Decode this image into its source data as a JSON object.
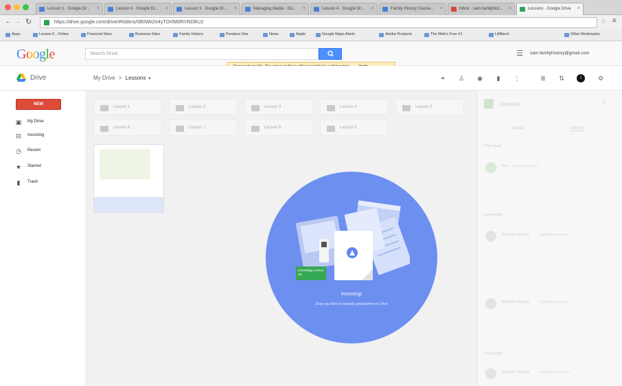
{
  "browser": {
    "tabs": [
      {
        "label": "Lesson 1 · Google Dr..."
      },
      {
        "label": "Lesson 6 · Google Dr..."
      },
      {
        "label": "Lesson 3 · Google Dr..."
      },
      {
        "label": "Managing Media · Do..."
      },
      {
        "label": "Lesson 4 · Google Dr..."
      },
      {
        "label": "Family History Classe..."
      },
      {
        "label": "Inbox · sam.familyhist..."
      },
      {
        "label": "Lessons · Google Drive"
      }
    ],
    "url": "https://drive.google.com/drive/#folders/0B0WkZe4yTOr0M0RVNDlkU2",
    "bookmarks": [
      "Apps",
      "Lesson 6 · Online",
      "Financial Sites",
      "Business Sites",
      "Family History",
      "Pandora One",
      "News",
      "Apple",
      "Google Maps Alerts",
      "Adobe Products",
      "The Web's Free #1",
      "LABtech",
      "Other Bookmarks"
    ]
  },
  "google_bar": {
    "logo": "Google",
    "search_placeholder": "Search Drive",
    "account": "sam.familyhistory@gmail.com"
  },
  "notification": {
    "message": "Removed one file. The removed file is still accessible by collaborators.",
    "undo": "Undo"
  },
  "drive_bar": {
    "app_name": "Drive",
    "breadcrumb_root": "My Drive",
    "breadcrumb_sep": ">",
    "breadcrumb_current": "Lessons"
  },
  "sidebar": {
    "new_label": "NEW",
    "items": [
      {
        "label": "My Drive"
      },
      {
        "label": "Incoming"
      },
      {
        "label": "Recent"
      },
      {
        "label": "Starred"
      },
      {
        "label": "Trash"
      }
    ]
  },
  "folders": [
    "Lesson 1",
    "Lesson 2",
    "Lesson 3",
    "Lesson 4",
    "Lesson 5",
    "Lesson 6",
    "Lesson 7",
    "Lesson 8",
    "Lesson 9"
  ],
  "upload_overlay": {
    "sticker_text": "Genealogy Lesson 4B",
    "title": "Incoming!",
    "subtitle": "Drop your files to instantly upload them to Drive"
  },
  "details_panel": {
    "title": "Lessons",
    "tabs": [
      "Details",
      "Activity"
    ],
    "sections": [
      "This week",
      "Last month",
      "Last month"
    ],
    "entries": [
      {
        "user": "You",
        "text": "moved an item"
      },
      {
        "user": "Stephen Shipley",
        "text": "uploaded an item"
      },
      {
        "user": "Stephen Shipley",
        "text": "uploaded an item"
      },
      {
        "user": "Stephen Shipley",
        "text": "uploaded an item"
      }
    ]
  },
  "colors": {
    "accent": "#4d90fe",
    "new_button": "#dd4b39",
    "overlay": "#6d8ff0",
    "toast_bg": "#f9edbe"
  }
}
